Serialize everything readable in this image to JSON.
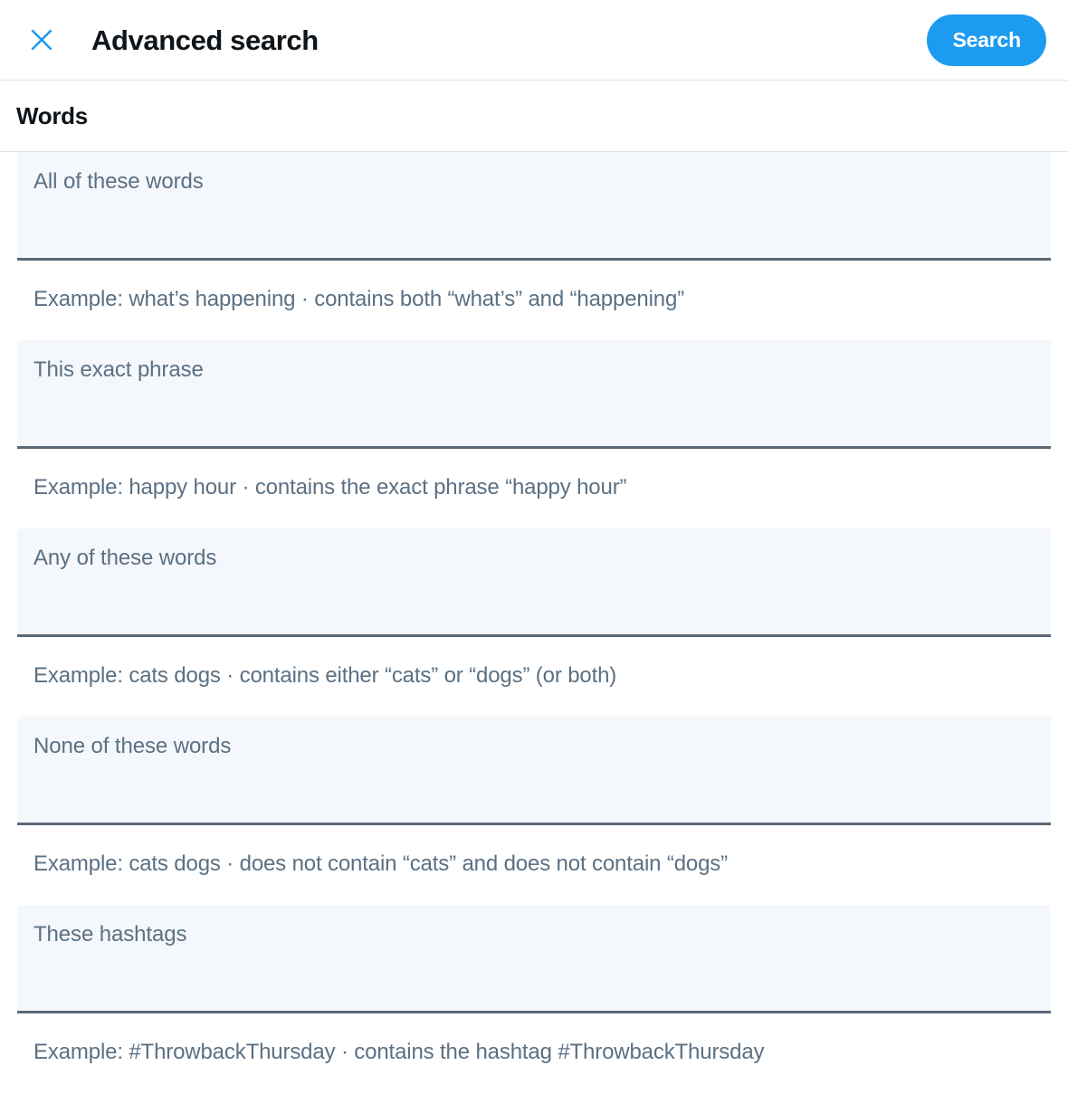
{
  "header": {
    "close_icon": "close-icon",
    "title": "Advanced search",
    "search_button": "Search"
  },
  "section": {
    "title": "Words"
  },
  "fields": [
    {
      "label": "All of these words",
      "value": "",
      "example": "Example: what’s happening · contains both “what’s” and “happening”"
    },
    {
      "label": "This exact phrase",
      "value": "",
      "example": "Example: happy hour · contains the exact phrase “happy hour”"
    },
    {
      "label": "Any of these words",
      "value": "",
      "example": "Example: cats dogs · contains either “cats” or “dogs” (or both)"
    },
    {
      "label": "None of these words",
      "value": "",
      "example": "Example: cats dogs · does not contain “cats” and does not contain “dogs”"
    },
    {
      "label": "These hashtags",
      "value": "",
      "example": "Example: #ThrowbackThursday · contains the hashtag #ThrowbackThursday"
    }
  ],
  "colors": {
    "accent": "#1d9bf0",
    "text_primary": "#0f1419",
    "text_secondary": "#5b7083",
    "field_bg": "#f4f7fb",
    "field_underline": "#5b6876",
    "divider": "#dfe3e6"
  }
}
